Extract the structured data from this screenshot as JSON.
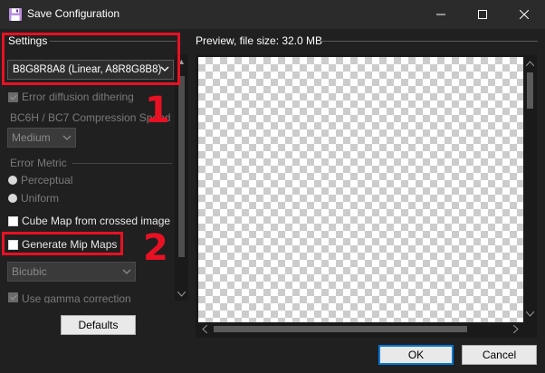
{
  "window": {
    "title": "Save Configuration",
    "icon": "floppy-disk-icon",
    "controls": [
      "minimize-icon",
      "maximize-icon",
      "close-icon"
    ]
  },
  "settings": {
    "group_label": "Settings",
    "format_value": "B8G8R8A8 (Linear, A8R8G8B8)",
    "error_diffusion": "Error diffusion dithering",
    "compression_label": "BC6H / BC7 Compression Speed",
    "compression_value": "Medium",
    "error_metric_label": "Error Metric",
    "error_metric_options": [
      "Perceptual",
      "Uniform"
    ],
    "cube_map": "Cube Map from crossed image",
    "generate_mips": "Generate Mip Maps",
    "filter_value": "Bicubic",
    "gamma": "Use gamma correction",
    "defaults_button": "Defaults"
  },
  "preview": {
    "label": "Preview, file size: 32.0 MB"
  },
  "footer": {
    "ok": "OK",
    "cancel": "Cancel"
  },
  "annotations": [
    "1",
    "2"
  ],
  "colors": {
    "annotation": "#e81123",
    "accent": "#0078d7"
  }
}
